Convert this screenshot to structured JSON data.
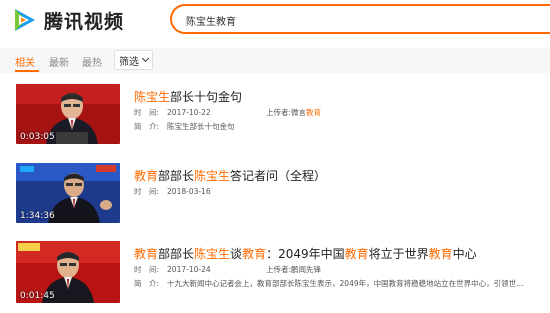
{
  "header": {
    "logo_text": "腾讯视频",
    "search_value": "陈宝生教育"
  },
  "tabs": {
    "items": [
      "相关",
      "最新",
      "最热"
    ],
    "filter_label": "筛选"
  },
  "results": [
    {
      "duration": "0:03:05",
      "title_parts": [
        {
          "text": "陈宝生",
          "hl": true
        },
        {
          "text": "部长十句金句",
          "hl": false
        }
      ],
      "time_label": "时　间:",
      "time_value": "2017-10-22",
      "uploader_label": "上传者:",
      "uploader_parts": [
        {
          "text": "微言",
          "hl": false
        },
        {
          "text": "教育",
          "hl": true
        }
      ],
      "intro_label": "简　介:",
      "intro_value": "陈宝生部长十句金句"
    },
    {
      "duration": "1:34:36",
      "title_parts": [
        {
          "text": "教育",
          "hl": true
        },
        {
          "text": "部部长",
          "hl": false
        },
        {
          "text": "陈宝生",
          "hl": true
        },
        {
          "text": "答记者问（全程）",
          "hl": false
        }
      ],
      "time_label": "时　间:",
      "time_value": "2018-03-16"
    },
    {
      "duration": "0:01:45",
      "title_parts": [
        {
          "text": "教育",
          "hl": true
        },
        {
          "text": "部部长",
          "hl": false
        },
        {
          "text": "陈宝生",
          "hl": true
        },
        {
          "text": "谈",
          "hl": false
        },
        {
          "text": "教育",
          "hl": true
        },
        {
          "text": "：2049年中国",
          "hl": false
        },
        {
          "text": "教育",
          "hl": true
        },
        {
          "text": "将立于世界",
          "hl": false
        },
        {
          "text": "教育",
          "hl": true
        },
        {
          "text": "中心",
          "hl": false
        }
      ],
      "time_label": "时　间:",
      "time_value": "2017-10-24",
      "uploader_label": "上传者:",
      "uploader_parts": [
        {
          "text": "鹏闻先锋",
          "hl": false
        }
      ],
      "intro_label": "简　介:",
      "intro_value": "十九大新闻中心记者会上，教育部部长陈宝生表示，2049年，中国教育将稳稳地站立在世界中心，引领世…"
    }
  ],
  "colors": {
    "accent": "#ff6a00",
    "logo_blue": "#1aa0f0",
    "logo_green": "#7dc73b",
    "logo_orange": "#ff8a00"
  },
  "icons": {
    "logo": "tencent-video-logo-icon",
    "filter": "chevron-down-icon"
  }
}
